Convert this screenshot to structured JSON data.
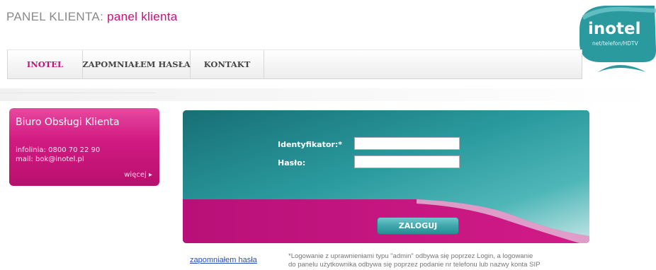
{
  "header": {
    "title_prefix": "PANEL KLIENTA:",
    "title_accent": "panel klienta"
  },
  "logo": {
    "name": "inotel",
    "tagline": "net/telefon/HDTV"
  },
  "nav": {
    "items": [
      {
        "label": "INOTEL",
        "active": true
      },
      {
        "label": "ZAPOMNIAŁEM HASŁA",
        "active": false
      },
      {
        "label": "KONTAKT",
        "active": false
      }
    ]
  },
  "bok_box": {
    "title": "Biuro Obsługi Klienta",
    "phone_line": "infolinia:  0800 70 22 90",
    "mail_line": "mail:  bok@inotel.pl",
    "more_label": "więcej"
  },
  "login_form": {
    "id_label": "Identyfikator:*",
    "id_value": "",
    "password_label": "Hasło:",
    "password_value": "",
    "submit_label": "ZALOGUJ"
  },
  "footer": {
    "forgot_link": "zapomniałem hasła",
    "note_line1": "*Logowanie z uprawnieniami typu \"admin\" odbywa się poprzez Login, a logowanie",
    "note_line2": "do panelu użytkownika odbywa się poprzez podanie nr telefonu lub nazwy konta SIP"
  },
  "colors": {
    "accent_magenta": "#c8107a",
    "teal": "#1e8c91",
    "link_blue": "#2a50b8"
  }
}
